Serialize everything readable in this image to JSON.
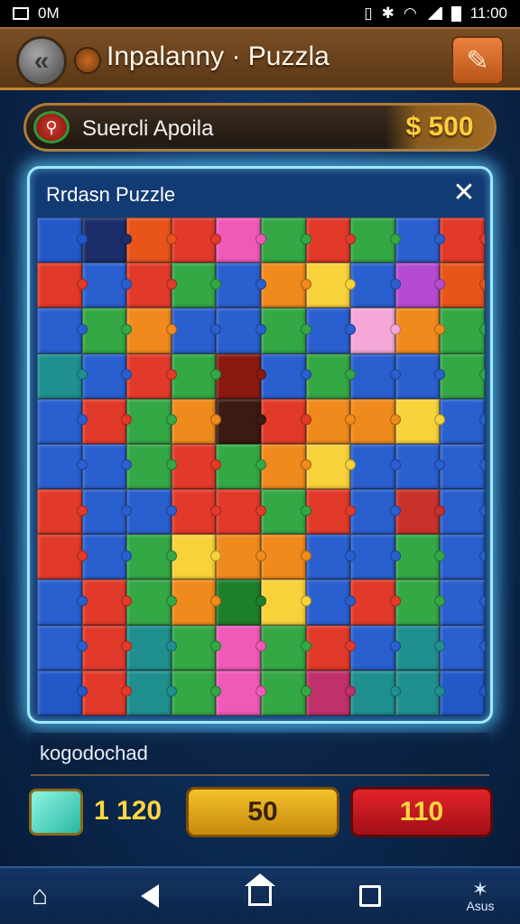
{
  "status_bar": {
    "carrier": "0M",
    "time": "11:00"
  },
  "header": {
    "title": "Inpalanny · Puzzla"
  },
  "search_bar": {
    "text": "Suercli Apoila",
    "coins": "$ 500"
  },
  "panel": {
    "title": "Rrdasn Puzzle"
  },
  "board": {
    "columns": 10,
    "rows": 11,
    "pieces": [
      "#2358c9",
      "#1c2d6b",
      "#e8541a",
      "#e23a2a",
      "#ef5ab8",
      "#34a845",
      "#e23a2a",
      "#34a845",
      "#2a5fcf",
      "#e23a2a",
      "#e23a2a",
      "#2a5fcf",
      "#e23a2a",
      "#34a845",
      "#2a5fcf",
      "#f08a1c",
      "#f7d23a",
      "#2a5fcf",
      "#b54bd1",
      "#e8541a",
      "#2a5fcf",
      "#34a845",
      "#f08a1c",
      "#2a5fcf",
      "#2a5fcf",
      "#34a845",
      "#2a5fcf",
      "#f5a8d8",
      "#f08a1c",
      "#34a845",
      "#1f8f8f",
      "#2a5fcf",
      "#e23a2a",
      "#34a845",
      "#8a1a10",
      "#2a5fcf",
      "#34a845",
      "#2a5fcf",
      "#2a5fcf",
      "#34a845",
      "#2a5fcf",
      "#e23a2a",
      "#34a845",
      "#f08a1c",
      "#3a1a12",
      "#e23a2a",
      "#f08a1c",
      "#f08a1c",
      "#f7d23a",
      "#2a5fcf",
      "#2a5fcf",
      "#2a5fcf",
      "#34a845",
      "#e23a2a",
      "#34a845",
      "#f08a1c",
      "#f7d23a",
      "#2a5fcf",
      "#2a5fcf",
      "#2a5fcf",
      "#e23a2a",
      "#2a5fcf",
      "#2a5fcf",
      "#e23a2a",
      "#e23a2a",
      "#34a845",
      "#e23a2a",
      "#2a5fcf",
      "#c8322a",
      "#2a5fcf",
      "#e23a2a",
      "#2a5fcf",
      "#34a845",
      "#f7d23a",
      "#f08a1c",
      "#f08a1c",
      "#2a5fcf",
      "#2a5fcf",
      "#34a845",
      "#2a5fcf",
      "#2a5fcf",
      "#e23a2a",
      "#34a845",
      "#f08a1c",
      "#1e7f2a",
      "#f7d23a",
      "#2a5fcf",
      "#e23a2a",
      "#34a845",
      "#2a5fcf",
      "#2a5fcf",
      "#e23a2a",
      "#1f8f8f",
      "#34a845",
      "#ef5ab8",
      "#34a845",
      "#e23a2a",
      "#2a5fcf",
      "#1f8f8f",
      "#2a5fcf",
      "#2358c9",
      "#e23a2a",
      "#1f8f8f",
      "#34a845",
      "#ef5ab8",
      "#34a845",
      "#c0306a",
      "#1f8f8f",
      "#1f8f8f",
      "#2358c9"
    ]
  },
  "info_bar": {
    "text": "kogodochad"
  },
  "actions": {
    "gems": "1 120",
    "gold_button": "50",
    "red_button": "110"
  },
  "nav": {
    "corner_label": "Asus"
  }
}
